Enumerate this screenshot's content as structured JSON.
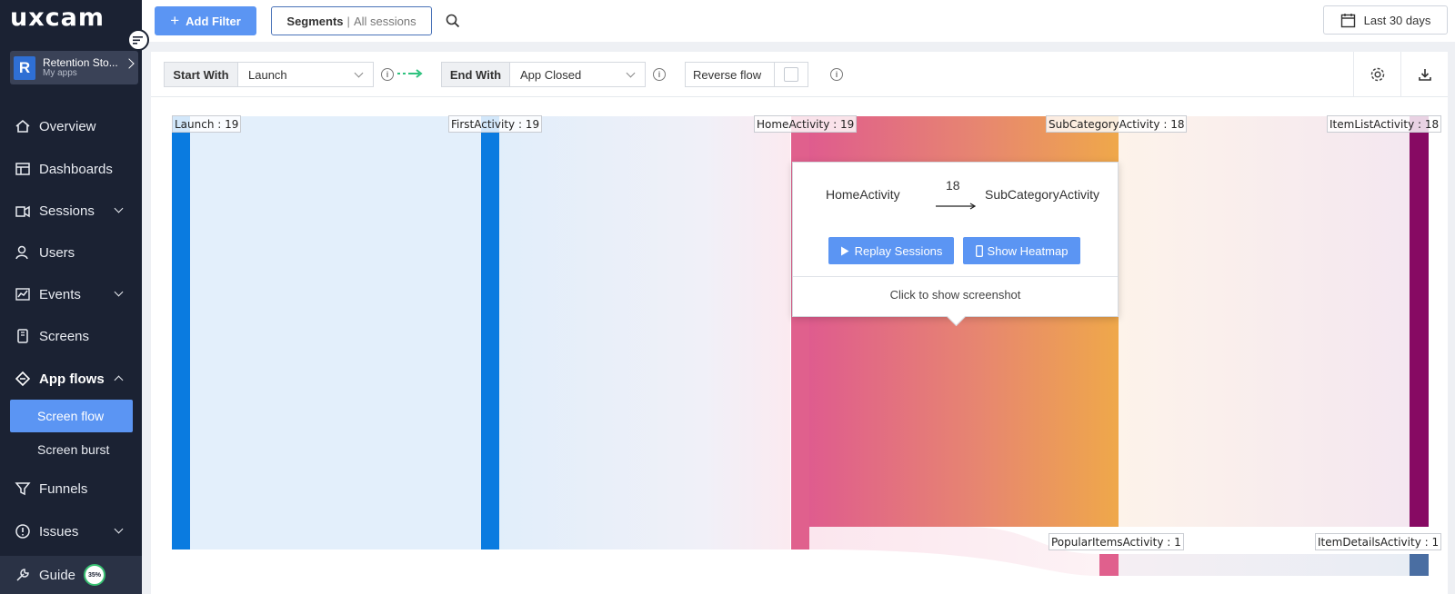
{
  "brand": {
    "logo": "uxcam"
  },
  "app": {
    "avatar_letter": "R",
    "name": "Retention Sto...",
    "subtitle": "My apps"
  },
  "sidebar": {
    "items": [
      {
        "label": "Overview",
        "icon": "home-icon"
      },
      {
        "label": "Dashboards",
        "icon": "dashboard-icon"
      },
      {
        "label": "Sessions",
        "icon": "sessions-icon",
        "expandable": true
      },
      {
        "label": "Users",
        "icon": "users-icon"
      },
      {
        "label": "Events",
        "icon": "events-icon",
        "expandable": true
      },
      {
        "label": "Screens",
        "icon": "screens-icon"
      },
      {
        "label": "App flows",
        "icon": "app-flows-icon",
        "expanded": true
      },
      {
        "label": "Funnels",
        "icon": "funnels-icon"
      },
      {
        "label": "Issues",
        "icon": "issues-icon",
        "expandable": true
      }
    ],
    "subitems": [
      {
        "label": "Screen flow",
        "active": true
      },
      {
        "label": "Screen burst",
        "active": false
      }
    ],
    "guide": {
      "label": "Guide",
      "progress": "35%"
    }
  },
  "topbar": {
    "add_filter": "Add Filter",
    "segments_label": "Segments",
    "segments_value": "All sessions",
    "date_range": "Last 30 days"
  },
  "controls": {
    "start_label": "Start With",
    "start_value": "Launch",
    "end_label": "End With",
    "end_value": "App Closed",
    "reverse_label": "Reverse flow",
    "reverse_checked": false
  },
  "flow": {
    "nodes": [
      {
        "name": "Launch",
        "count": 19,
        "label": "Launch : 19",
        "color": "#0a7be0"
      },
      {
        "name": "FirstActivity",
        "count": 19,
        "label": "FirstActivity : 19",
        "color": "#0a7be0"
      },
      {
        "name": "HomeActivity",
        "count": 19,
        "label": "HomeActivity : 19",
        "color": "#e0608d"
      },
      {
        "name": "SubCategoryActivity",
        "count": 18,
        "label": "SubCategoryActivity : 18",
        "color": "#eca24a"
      },
      {
        "name": "ItemListActivity",
        "count": 18,
        "label": "ItemListActivity : 18",
        "color": "#870a63"
      },
      {
        "name": "PopularItemsActivity",
        "count": 1,
        "label": "PopularItemsActivity : 1",
        "color": "#e0608d"
      },
      {
        "name": "ItemDetailsActivity",
        "count": 1,
        "label": "ItemDetailsActivity : 1",
        "color": "#4a6ea2"
      }
    ]
  },
  "tooltip": {
    "from": "HomeActivity",
    "count": "18",
    "to": "SubCategoryActivity",
    "replay_button": "Replay Sessions",
    "heatmap_button": "Show Heatmap",
    "footer": "Click to show screenshot"
  },
  "colors": {
    "accent": "#5b95f3",
    "sidebar_bg": "#1b2233",
    "flow_blue": "#0a7be0"
  }
}
